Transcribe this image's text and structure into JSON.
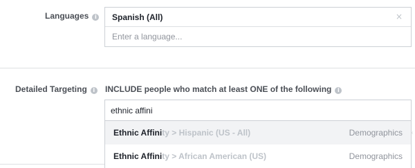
{
  "languages": {
    "label": "Languages",
    "info_icon": "i",
    "selected": "Spanish (All)",
    "remove_icon": "×",
    "placeholder": "Enter a language..."
  },
  "detailed_targeting": {
    "label": "Detailed Targeting",
    "info_icon": "i",
    "include_text": "INCLUDE people who match at least ONE of the following",
    "include_info_icon": "i",
    "search_value": "ethnic affini",
    "suggestions": [
      {
        "match": "Ethnic Affini",
        "rest": "ty > Hispanic (US - All)",
        "category": "Demographics"
      },
      {
        "match": "Ethnic Affini",
        "rest": "ty > African American (US)",
        "category": "Demographics"
      }
    ]
  }
}
